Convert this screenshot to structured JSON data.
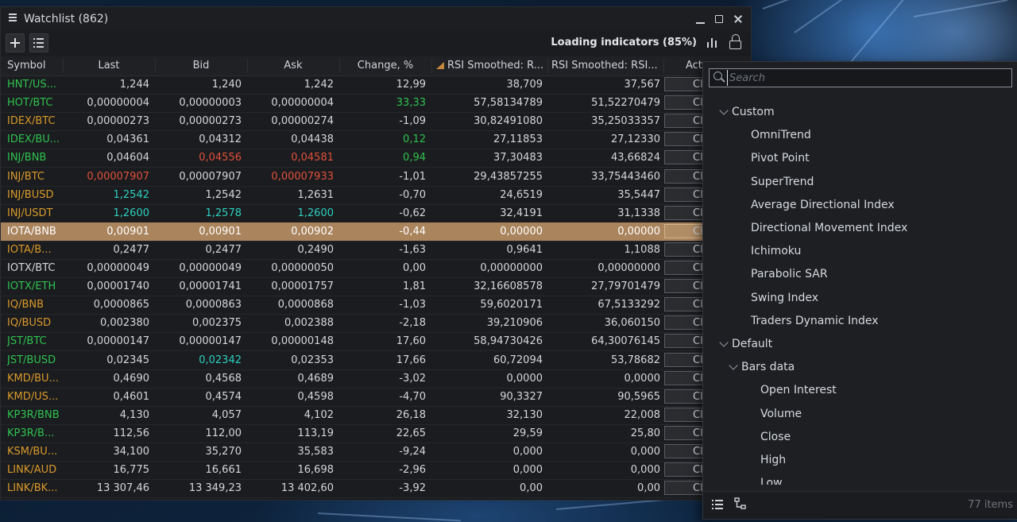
{
  "window": {
    "title": "Watchlist (862)",
    "loading_text": "Loading indicators (85%)"
  },
  "columns": [
    {
      "label": "Symbol"
    },
    {
      "label": "Last"
    },
    {
      "label": "Bid"
    },
    {
      "label": "Ask"
    },
    {
      "label": "Change, %"
    },
    {
      "label": "RSI Smoothed: R..."
    },
    {
      "label": "RSI Smoothed: RSI..."
    },
    {
      "label": "Act"
    }
  ],
  "colors": {
    "green": "#2ec24f",
    "orange": "#d99a2b",
    "red": "#e0503c",
    "teal": "#2dd0c0",
    "default": "#d4d7db",
    "selected_bg": "#a9845d"
  },
  "rows": [
    {
      "symbol": "HNT/US...",
      "sym_color": "green",
      "last": "1,244",
      "bid": "1,240",
      "ask": "1,242",
      "change": "12,99",
      "rsi1": "38,709",
      "rsi2": "37,567",
      "action": "Cl",
      "selected": false
    },
    {
      "symbol": "HOT/BTC",
      "sym_color": "green",
      "last": "0,00000004",
      "bid": "0,00000003",
      "ask": "0,00000004",
      "change": "33,33",
      "change_color": "green",
      "rsi1": "57,58134789",
      "rsi2": "51,52270479",
      "action": "Cl",
      "selected": false
    },
    {
      "symbol": "IDEX/BTC",
      "sym_color": "orange",
      "last": "0,00000273",
      "bid": "0,00000273",
      "ask": "0,00000274",
      "change": "-1,09",
      "rsi1": "30,82491080",
      "rsi2": "35,25033357",
      "action": "Cl",
      "selected": false
    },
    {
      "symbol": "IDEX/BU...",
      "sym_color": "green",
      "last": "0,04361",
      "bid": "0,04312",
      "ask": "0,04438",
      "change": "0,12",
      "change_color": "green",
      "rsi1": "27,11853",
      "rsi2": "27,12330",
      "action": "Cl",
      "selected": false
    },
    {
      "symbol": "INJ/BNB",
      "sym_color": "green",
      "last": "0,04604",
      "bid": "0,04556",
      "bid_color": "red",
      "ask": "0,04581",
      "ask_color": "red",
      "change": "0,94",
      "change_color": "green",
      "rsi1": "37,30483",
      "rsi2": "43,66824",
      "action": "Cl",
      "selected": false
    },
    {
      "symbol": "INJ/BTC",
      "sym_color": "orange",
      "last": "0,00007907",
      "last_color": "red",
      "bid": "0,00007907",
      "ask": "0,00007933",
      "ask_color": "red",
      "change": "-1,01",
      "rsi1": "29,43857255",
      "rsi2": "33,75443460",
      "action": "Cl",
      "selected": false
    },
    {
      "symbol": "INJ/BUSD",
      "sym_color": "orange",
      "last": "1,2542",
      "last_color": "teal",
      "bid": "1,2542",
      "ask": "1,2631",
      "change": "-0,70",
      "rsi1": "24,6519",
      "rsi2": "35,5447",
      "action": "Cl",
      "selected": false
    },
    {
      "symbol": "INJ/USDT",
      "sym_color": "orange",
      "last": "1,2600",
      "last_color": "teal",
      "bid": "1,2578",
      "bid_color": "teal",
      "ask": "1,2600",
      "ask_color": "teal",
      "change": "-0,62",
      "rsi1": "32,4191",
      "rsi2": "31,1338",
      "action": "Cl",
      "selected": false
    },
    {
      "symbol": "IOTA/BNB",
      "sym_color": "default",
      "last": "0,00901",
      "bid": "0,00901",
      "ask": "0,00902",
      "change": "-0,44",
      "rsi1": "0,00000",
      "rsi2": "0,00000",
      "action": "Cl",
      "selected": true
    },
    {
      "symbol": "IOTA/B...",
      "sym_color": "orange",
      "last": "0,2477",
      "bid": "0,2477",
      "ask": "0,2490",
      "change": "-1,63",
      "rsi1": "0,9641",
      "rsi2": "1,1088",
      "action": "Cl",
      "selected": false
    },
    {
      "symbol": "IOTX/BTC",
      "sym_color": "default",
      "last": "0,00000049",
      "bid": "0,00000049",
      "ask": "0,00000050",
      "change": "0,00",
      "rsi1": "0,00000000",
      "rsi2": "0,00000000",
      "action": "Cl",
      "selected": false
    },
    {
      "symbol": "IOTX/ETH",
      "sym_color": "green",
      "last": "0,00001740",
      "bid": "0,00001741",
      "ask": "0,00001757",
      "change": "1,81",
      "rsi1": "32,16608578",
      "rsi2": "27,79701479",
      "action": "Cl",
      "selected": false
    },
    {
      "symbol": "IQ/BNB",
      "sym_color": "orange",
      "last": "0,0000865",
      "bid": "0,0000863",
      "ask": "0,0000868",
      "change": "-1,03",
      "rsi1": "59,6020171",
      "rsi2": "67,5133292",
      "action": "Cl",
      "selected": false
    },
    {
      "symbol": "IQ/BUSD",
      "sym_color": "orange",
      "last": "0,002380",
      "bid": "0,002375",
      "ask": "0,002388",
      "change": "-2,18",
      "rsi1": "39,210906",
      "rsi2": "36,060150",
      "action": "Cl",
      "selected": false
    },
    {
      "symbol": "JST/BTC",
      "sym_color": "green",
      "last": "0,00000147",
      "bid": "0,00000147",
      "ask": "0,00000148",
      "change": "17,60",
      "rsi1": "58,94730426",
      "rsi2": "64,30076145",
      "action": "Cl",
      "selected": false
    },
    {
      "symbol": "JST/BUSD",
      "sym_color": "green",
      "last": "0,02345",
      "bid": "0,02342",
      "bid_color": "teal",
      "ask": "0,02353",
      "change": "17,66",
      "rsi1": "60,72094",
      "rsi2": "53,78682",
      "action": "Cl",
      "selected": false
    },
    {
      "symbol": "KMD/BU...",
      "sym_color": "orange",
      "last": "0,4690",
      "bid": "0,4568",
      "ask": "0,4689",
      "change": "-3,02",
      "rsi1": "0,0000",
      "rsi2": "0,0000",
      "action": "Cl",
      "selected": false
    },
    {
      "symbol": "KMD/US...",
      "sym_color": "orange",
      "last": "0,4601",
      "bid": "0,4574",
      "ask": "0,4598",
      "change": "-4,70",
      "rsi1": "90,3327",
      "rsi2": "90,5965",
      "action": "Cl",
      "selected": false
    },
    {
      "symbol": "KP3R/BNB",
      "sym_color": "green",
      "last": "4,130",
      "bid": "4,057",
      "ask": "4,102",
      "change": "26,18",
      "rsi1": "32,130",
      "rsi2": "22,008",
      "action": "Cl",
      "selected": false
    },
    {
      "symbol": "KP3R/B...",
      "sym_color": "green",
      "last": "112,56",
      "bid": "112,00",
      "ask": "113,19",
      "change": "22,65",
      "rsi1": "29,59",
      "rsi2": "25,80",
      "action": "Cl",
      "selected": false
    },
    {
      "symbol": "KSM/BU...",
      "sym_color": "orange",
      "last": "34,100",
      "bid": "35,270",
      "ask": "35,583",
      "change": "-9,24",
      "rsi1": "0,000",
      "rsi2": "0,000",
      "action": "Cl",
      "selected": false
    },
    {
      "symbol": "LINK/AUD",
      "sym_color": "orange",
      "last": "16,775",
      "bid": "16,661",
      "ask": "16,698",
      "change": "-2,96",
      "rsi1": "0,000",
      "rsi2": "0,000",
      "action": "Cl",
      "selected": false
    },
    {
      "symbol": "LINK/BK...",
      "sym_color": "orange",
      "last": "13 307,46",
      "bid": "13 349,23",
      "ask": "13 402,60",
      "change": "-3,92",
      "rsi1": "0,00",
      "rsi2": "0,00",
      "action": "Cl",
      "selected": false
    }
  ],
  "panel": {
    "search_placeholder": "Search",
    "tree": [
      {
        "label": "Custom",
        "level": 0,
        "expandable": true
      },
      {
        "label": "OmniTrend",
        "level": 1
      },
      {
        "label": "Pivot Point",
        "level": 1
      },
      {
        "label": "SuperTrend",
        "level": 1
      },
      {
        "label": "Average Directional Index",
        "level": 1
      },
      {
        "label": "Directional Movement Index",
        "level": 1
      },
      {
        "label": "Ichimoku",
        "level": 1
      },
      {
        "label": "Parabolic SAR",
        "level": 1
      },
      {
        "label": "Swing Index",
        "level": 1
      },
      {
        "label": "Traders Dynamic Index",
        "level": 1
      },
      {
        "label": "Default",
        "level": 0,
        "expandable": true
      },
      {
        "label": "Bars data",
        "level": 1,
        "expandable": true
      },
      {
        "label": "Open Interest",
        "level": 2
      },
      {
        "label": "Volume",
        "level": 2
      },
      {
        "label": "Close",
        "level": 2
      },
      {
        "label": "High",
        "level": 2
      },
      {
        "label": "Low",
        "level": 2
      }
    ],
    "item_count": "77 items"
  },
  "icons": {
    "menu": "hamburger-icon",
    "minimize": "minimize-icon",
    "maximize": "maximize-icon",
    "close": "close-icon",
    "add": "plus-icon",
    "list": "list-icon",
    "chart": "bar-chart-icon",
    "lock": "lock-icon",
    "search": "search-icon",
    "tree": "tree-icon"
  }
}
